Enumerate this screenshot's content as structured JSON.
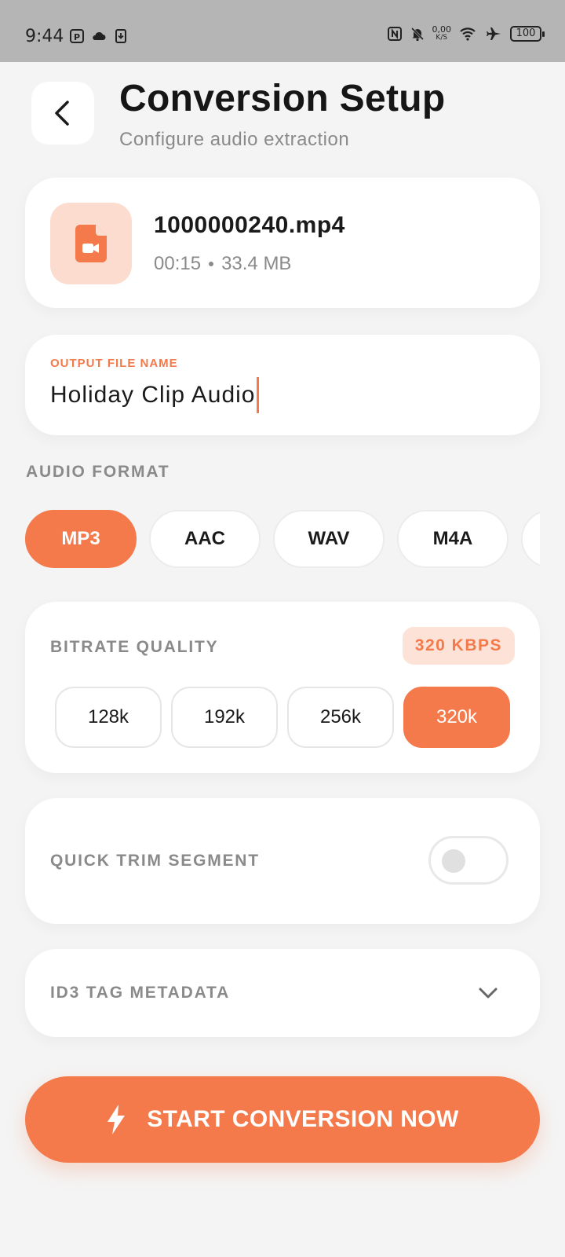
{
  "status_bar": {
    "time": "9:44",
    "net_speed_value": "0,00",
    "net_speed_unit": "K/S",
    "battery": "100"
  },
  "header": {
    "title": "Conversion Setup",
    "subtitle": "Configure audio extraction"
  },
  "file": {
    "name": "1000000240.mp4",
    "duration": "00:15",
    "size": "33.4 MB",
    "icon": "video-file-icon"
  },
  "output": {
    "label": "OUTPUT FILE NAME",
    "value": "Holiday Clip Audio"
  },
  "audio_format": {
    "label": "AUDIO FORMAT",
    "options": [
      "MP3",
      "AAC",
      "WAV",
      "M4A"
    ],
    "selected": "MP3"
  },
  "bitrate": {
    "label": "BITRATE QUALITY",
    "badge": "320 KBPS",
    "options": [
      "128k",
      "192k",
      "256k",
      "320k"
    ],
    "selected": "320k"
  },
  "trim": {
    "label": "QUICK TRIM SEGMENT",
    "enabled": false
  },
  "id3": {
    "label": "ID3 TAG METADATA"
  },
  "cta": {
    "label": "START CONVERSION NOW",
    "icon": "lightning-icon"
  },
  "colors": {
    "accent": "#f47a4c",
    "accent_light": "#fde2d7",
    "background": "#f4f4f4"
  }
}
